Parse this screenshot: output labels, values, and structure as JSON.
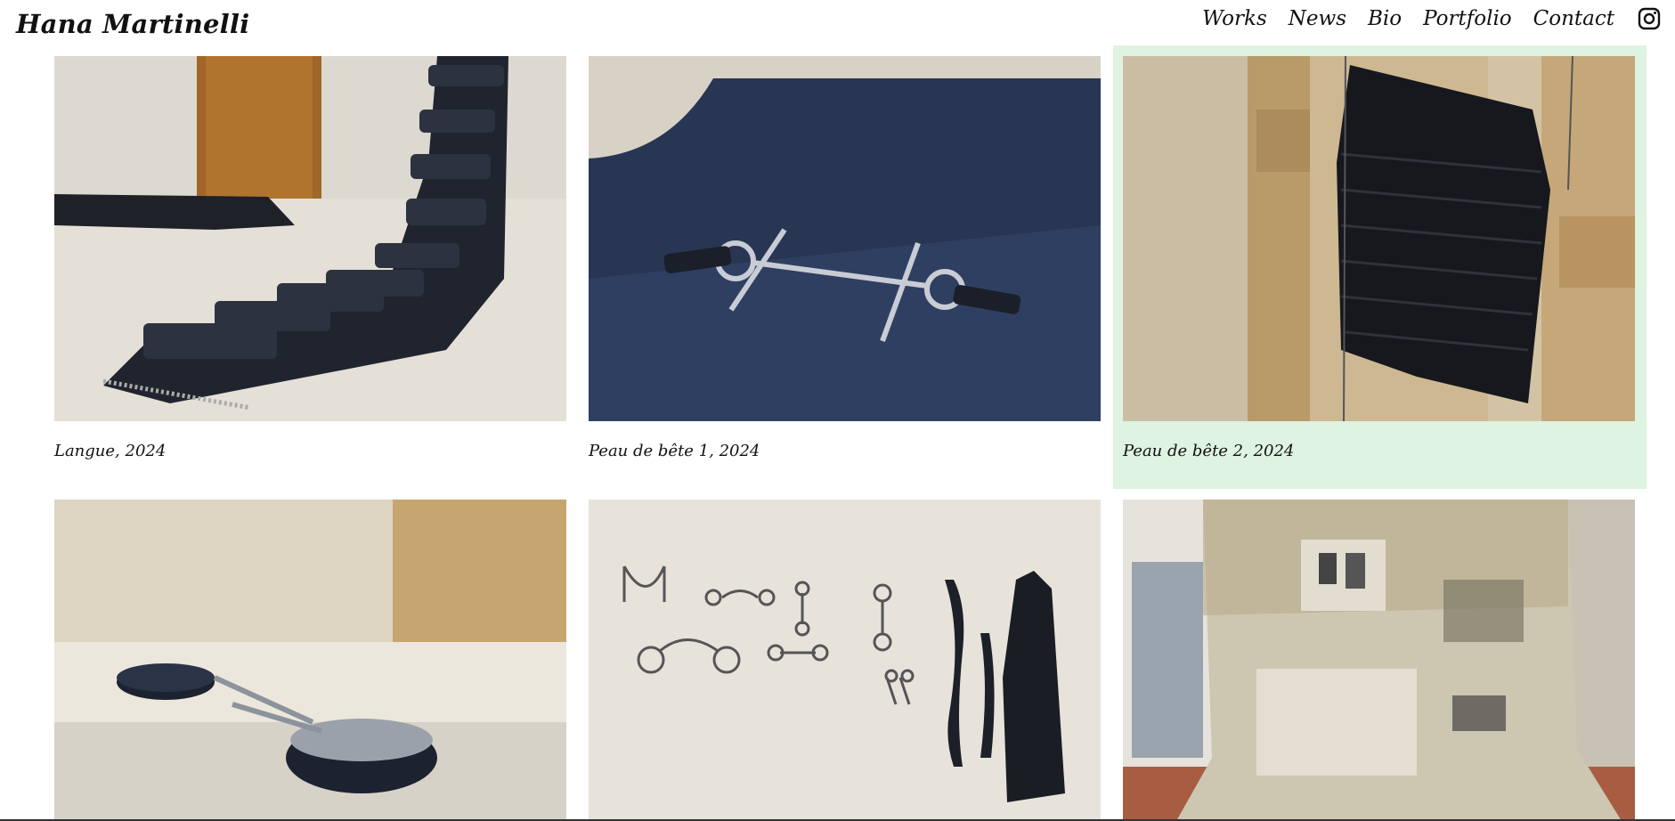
{
  "site": {
    "title": "Hana Martinelli"
  },
  "nav": {
    "items": [
      {
        "label": "Works"
      },
      {
        "label": "News"
      },
      {
        "label": "Bio"
      },
      {
        "label": "Portfolio"
      },
      {
        "label": "Contact"
      }
    ],
    "instagram_icon": "instagram-icon"
  },
  "works": [
    {
      "caption": "Langue, 2024",
      "image": "black rubber ridged strip on floor"
    },
    {
      "caption": "Peau de bête 1, 2024",
      "image": "horse bit on dark blue rubber sheet"
    },
    {
      "caption": "Peau de bête 2, 2024",
      "image": "black rubber strips hung on stone wall",
      "highlighted": true
    },
    {
      "caption": "",
      "image": "rubber collars with spikes on stone ledge"
    },
    {
      "caption": "",
      "image": "horse bits and rubber strands on white wall"
    },
    {
      "caption": "",
      "image": "hanging stained fabric installation"
    }
  ],
  "colors": {
    "highlight": "#def3e1"
  }
}
